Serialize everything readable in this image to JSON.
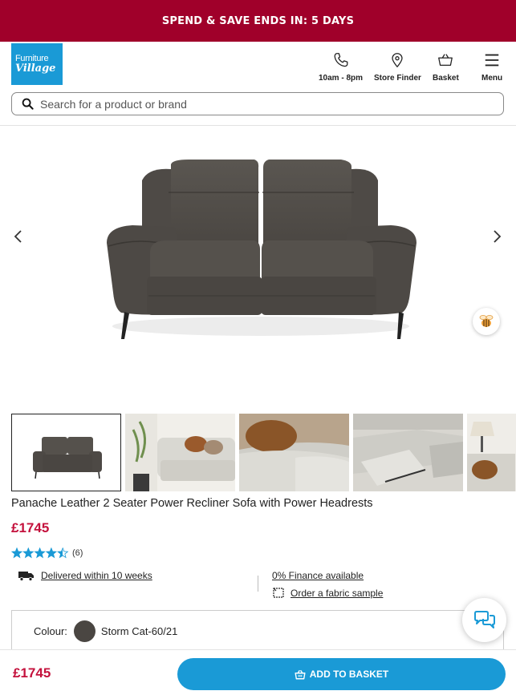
{
  "promo": {
    "text": "SPEND & SAVE ENDS IN: 5 DAYS"
  },
  "logo": {
    "line1": "Furniture",
    "line2": "Village"
  },
  "header": {
    "hours_label": "10am - 8pm",
    "store_finder_label": "Store Finder",
    "basket_label": "Basket",
    "menu_label": "Menu"
  },
  "search": {
    "placeholder": "Search for a product or brand"
  },
  "product": {
    "title": "Panache Leather 2 Seater Power Recliner Sofa with Power Headrests",
    "price": "£1745",
    "rating": 4.5,
    "review_count": "(6)",
    "delivery_text": "Delivered within 10 weeks",
    "finance_text": "0% Finance available",
    "sample_text": "Order a fabric sample",
    "colour_label": "Colour:",
    "colour_name": "Storm Cat-60/21",
    "colour_swatch": "#4a4642"
  },
  "bottom_bar": {
    "price": "£1745",
    "add_button_label": "ADD TO BASKET"
  },
  "colors": {
    "brand_red": "#a0002a",
    "price_red": "#c4123d",
    "accent_blue": "#1a9ad6",
    "star_blue": "#1a9ad6"
  }
}
